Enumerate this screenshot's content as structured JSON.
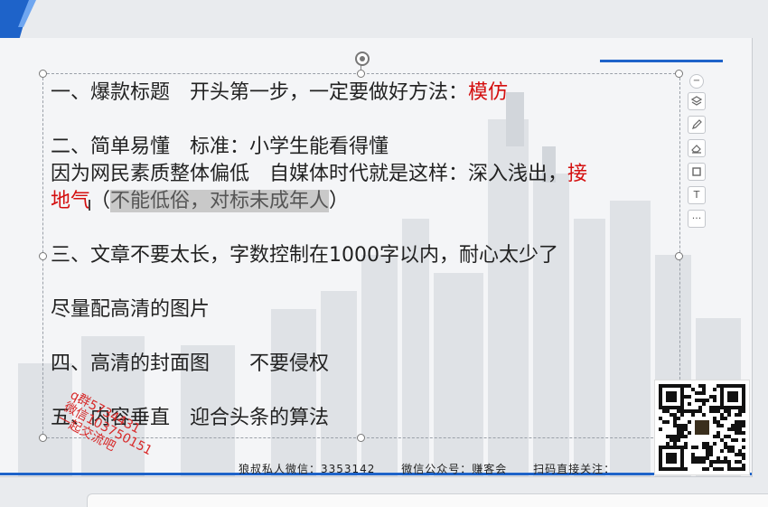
{
  "slide": {
    "lines": [
      {
        "id": "l1",
        "parts": [
          {
            "text": "一、爆款标题　开头第一步，一定要做好方法："
          },
          {
            "text": "模仿",
            "red": true
          }
        ]
      },
      {
        "id": "l2",
        "parts": [
          {
            "text": "二、简单易懂　标准：小学生能看得懂"
          }
        ]
      },
      {
        "id": "l3",
        "parts": [
          {
            "text": "因为网民素质整体偏低　自媒体时代就是这样：深入浅出，"
          },
          {
            "text": "接",
            "red": true
          }
        ]
      },
      {
        "id": "l4",
        "parts": [
          {
            "text": "地气",
            "red": true
          },
          {
            "text": "（"
          },
          {
            "text": "不能低俗，对标未成年人",
            "hl": true
          },
          {
            "text": "）"
          }
        ]
      },
      {
        "id": "l5",
        "parts": [
          {
            "text": "三、文章不要太长，字数控制在1000字以内，耐心太少了"
          }
        ]
      },
      {
        "id": "l6",
        "parts": [
          {
            "text": "尽量配高清的图片"
          }
        ]
      },
      {
        "id": "l7",
        "parts": [
          {
            "text": "四、高清的封面图　　不要侵权"
          }
        ]
      },
      {
        "id": "l8",
        "parts": [
          {
            "text": "五、内容垂直　迎合头条的算法"
          }
        ]
      }
    ],
    "watermark": [
      "q群5734431",
      "微信103750151",
      "一起交流吧"
    ],
    "footer": {
      "wechat_personal": "狼叔私人微信：3353142",
      "wechat_official": "微信公众号：赚客会",
      "scan": "扫码直接关注："
    }
  },
  "toolbar": {
    "items": [
      "collapse",
      "layers",
      "pen",
      "eraser",
      "crop",
      "text",
      "more"
    ],
    "more_label": "···",
    "collapse_label": "−",
    "text_label": "T"
  },
  "colors": {
    "accent": "#1e63c9",
    "highlight_red": "#d40f0f"
  }
}
